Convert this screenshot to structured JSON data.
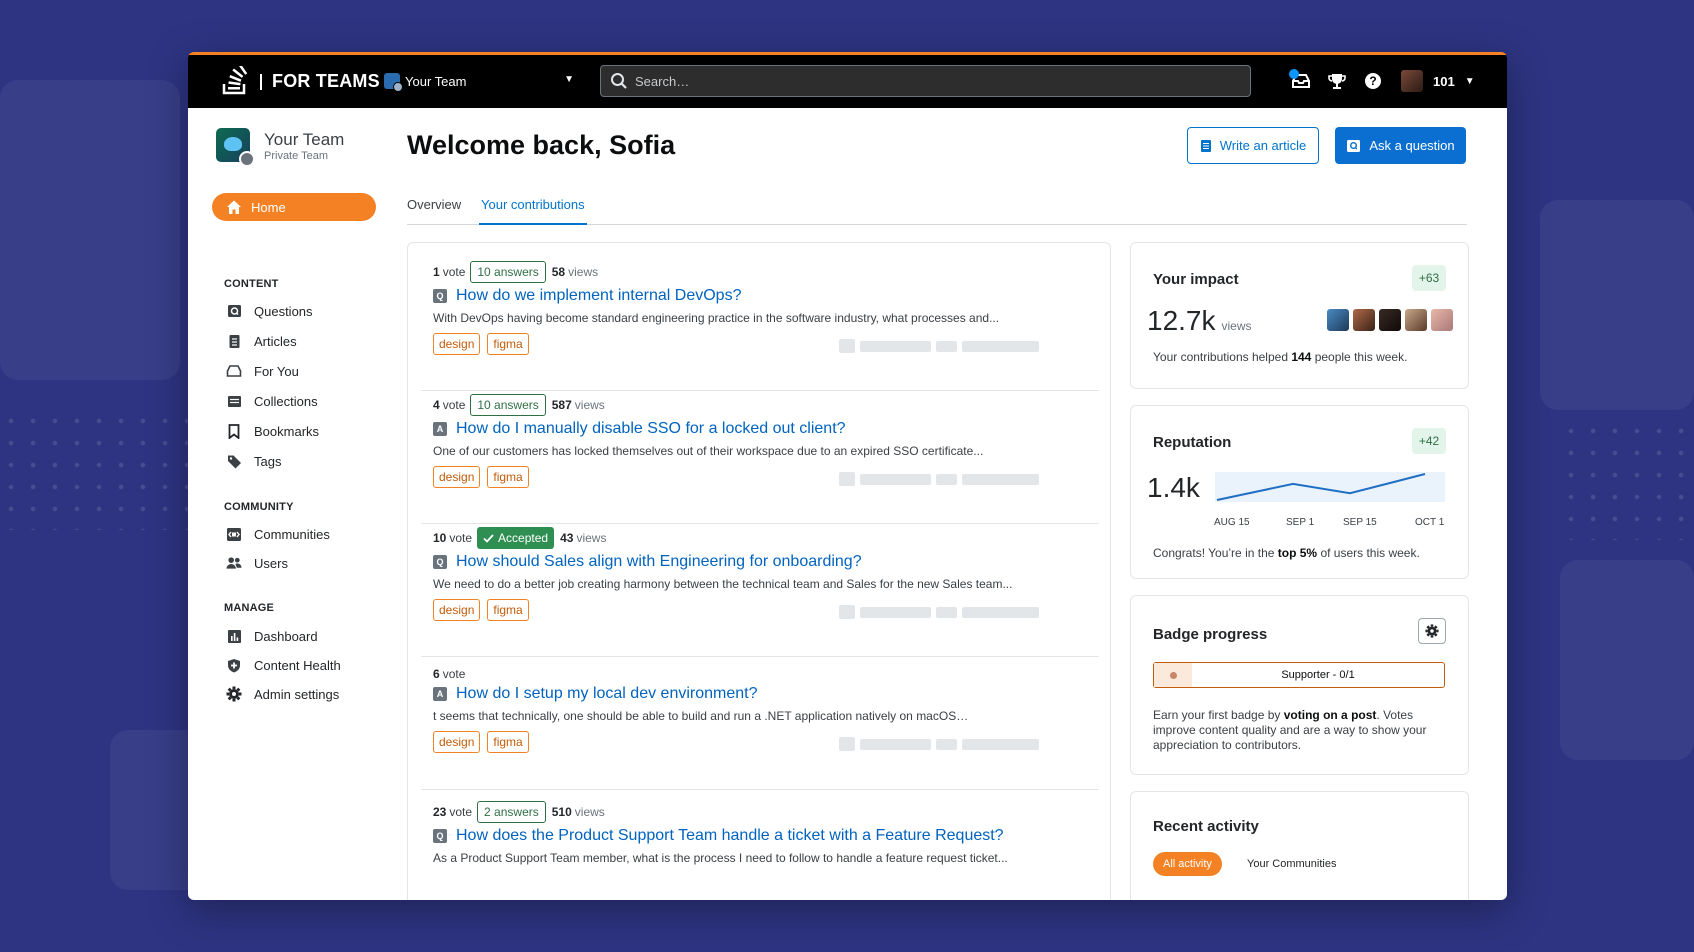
{
  "topbar": {
    "brand": "FOR TEAMS",
    "team_switcher": "Your Team",
    "search_placeholder": "Search…",
    "reputation": "101"
  },
  "sidebar": {
    "team_name": "Your Team",
    "team_type": "Private Team",
    "home": "Home",
    "sections": {
      "content": "CONTENT",
      "community": "COMMUNITY",
      "manage": "MANAGE"
    },
    "content_items": [
      "Questions",
      "Articles",
      "For You",
      "Collections",
      "Bookmarks",
      "Tags"
    ],
    "community_items": [
      "Communities",
      "Users"
    ],
    "manage_items": [
      "Dashboard",
      "Content Health",
      "Admin settings"
    ]
  },
  "main": {
    "welcome": "Welcome back, Sofia",
    "write_article": "Write an article",
    "ask_question": "Ask a question",
    "tabs": [
      "Overview",
      "Your contributions"
    ]
  },
  "questions": [
    {
      "votes": "1",
      "vote_label": "vote",
      "answers": "10 answers",
      "views": "58",
      "views_label": "views",
      "kind": "Q",
      "title": "How do we implement internal DevOps?",
      "excerpt": "With DevOps having become standard engineering practice in the software industry, what processes and...",
      "tags": [
        "design",
        "figma"
      ]
    },
    {
      "votes": "4",
      "vote_label": "vote",
      "answers": "10 answers",
      "views": "587",
      "views_label": "views",
      "kind": "A",
      "title": "How do I manually disable SSO for a locked out client?",
      "excerpt": "One of our customers has locked themselves out of their workspace due to an expired SSO certificate...",
      "tags": [
        "design",
        "figma"
      ]
    },
    {
      "votes": "10",
      "vote_label": "vote",
      "accepted": "Accepted",
      "views": "43",
      "views_label": "views",
      "kind": "Q",
      "title": "How should Sales align with Engineering for onboarding?",
      "excerpt": "We need to do a better job creating harmony between the technical team and Sales for the new Sales team...",
      "tags": [
        "design",
        "figma"
      ]
    },
    {
      "votes": "6",
      "vote_label": "vote",
      "kind": "A",
      "title": "How do I setup my local dev environment?",
      "excerpt": "t seems that technically, one should be able to build and run a .NET application natively on macOS…",
      "tags": [
        "design",
        "figma"
      ]
    },
    {
      "votes": "23",
      "vote_label": "vote",
      "answers": "2 answers",
      "views": "510",
      "views_label": "views",
      "kind": "Q",
      "title": "How does the Product Support Team handle a ticket with a Feature Request?",
      "excerpt": "As a Product Support Team member, what is the process I need to follow to handle a feature request ticket...",
      "tags": []
    }
  ],
  "impact": {
    "title": "Your impact",
    "delta": "+63",
    "views_value": "12.7k",
    "views_label": "views",
    "text_pre": "Your contributions helped ",
    "people": "144",
    "text_post": " people this week."
  },
  "reputation": {
    "title": "Reputation",
    "delta": "+42",
    "value": "1.4k",
    "chart_data": {
      "type": "line",
      "x": [
        "AUG 15",
        "SEP 1",
        "SEP 15",
        "OCT 1"
      ],
      "values": [
        0,
        0.62,
        0.26,
        1
      ]
    },
    "text_pre": "Congrats! You’re in the ",
    "top": "top 5%",
    "text_post": " of users this week."
  },
  "badge": {
    "title": "Badge progress",
    "progress_label": "Supporter - 0/1",
    "progress": 0,
    "text_pre": "Earn your first badge by ",
    "text_bold": "voting on a post",
    "text_post": ". Votes improve content quality and are a way to show your appreciation to contributors."
  },
  "activity": {
    "title": "Recent activity",
    "filters": [
      "All activity",
      "Your Communities"
    ]
  },
  "colors": {
    "accent": "#f48225",
    "link": "#0074cc",
    "background": "#2e3482"
  }
}
